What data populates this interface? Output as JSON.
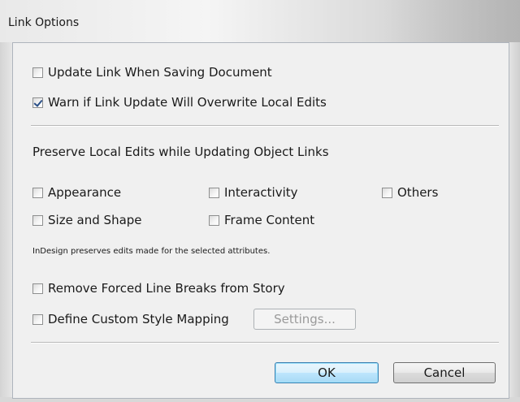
{
  "window": {
    "title": "Link Options"
  },
  "options": {
    "update_link_label": "Update Link When Saving Document",
    "update_link_checked": false,
    "warn_label": "Warn if Link Update Will Overwrite Local Edits",
    "warn_checked": true
  },
  "preserve": {
    "heading": "Preserve Local Edits while Updating Object Links",
    "items": [
      {
        "label": "Appearance",
        "checked": false
      },
      {
        "label": "Interactivity",
        "checked": false
      },
      {
        "label": "Others",
        "checked": false
      },
      {
        "label": "Size and Shape",
        "checked": false
      },
      {
        "label": "Frame Content",
        "checked": false
      }
    ],
    "hint": "InDesign preserves edits made for the selected attributes."
  },
  "story": {
    "remove_breaks_label": "Remove Forced Line Breaks from Story",
    "remove_breaks_checked": false,
    "custom_mapping_label": "Define Custom Style Mapping",
    "custom_mapping_checked": false,
    "settings_label": "Settings..."
  },
  "buttons": {
    "ok": "OK",
    "cancel": "Cancel"
  }
}
